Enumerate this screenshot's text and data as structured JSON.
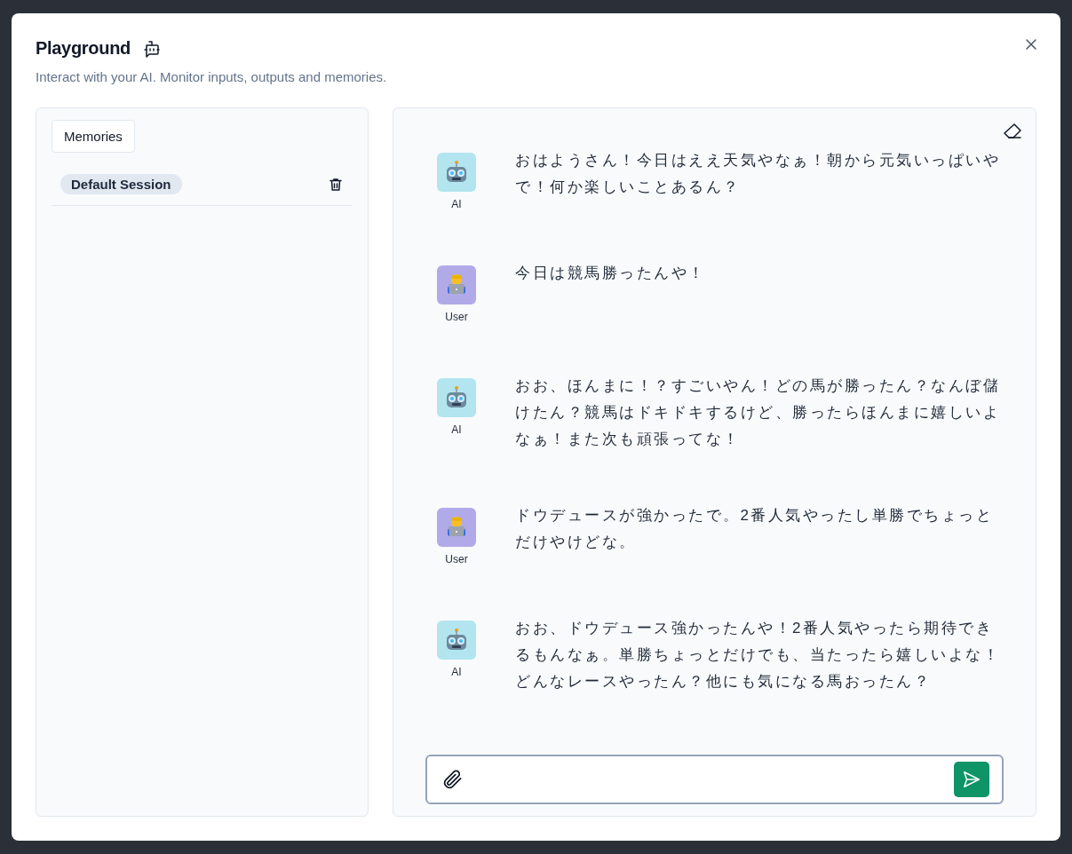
{
  "dialog": {
    "title": "Playground",
    "subtitle": "Interact with your AI. Monitor inputs, outputs and memories."
  },
  "memories": {
    "tab_label": "Memories",
    "sessions": [
      {
        "label": "Default Session"
      }
    ]
  },
  "messages": [
    {
      "kind": "ai",
      "author": "AI",
      "text": "おはようさん！今日はええ天気やなぁ！朝から元気いっぱいやで！何か楽しいことあるん？"
    },
    {
      "kind": "user",
      "author": "User",
      "text": "今日は競馬勝ったんや！"
    },
    {
      "kind": "ai",
      "author": "AI",
      "text": "おお、ほんまに！？すごいやん！どの馬が勝ったん？なんぼ儲けたん？競馬はドキドキするけど、勝ったらほんまに嬉しいよなぁ！また次も頑張ってな！"
    },
    {
      "kind": "user",
      "author": "User",
      "text": "ドウデュースが強かったで。2番人気やったし単勝でちょっとだけやけどな。"
    },
    {
      "kind": "ai",
      "author": "AI",
      "text": "おお、ドウデュース強かったんや！2番人気やったら期待できるもんなぁ。単勝ちょっとだけでも、当たったら嬉しいよな！どんなレースやったん？他にも気になる馬おったん？"
    }
  ]
}
